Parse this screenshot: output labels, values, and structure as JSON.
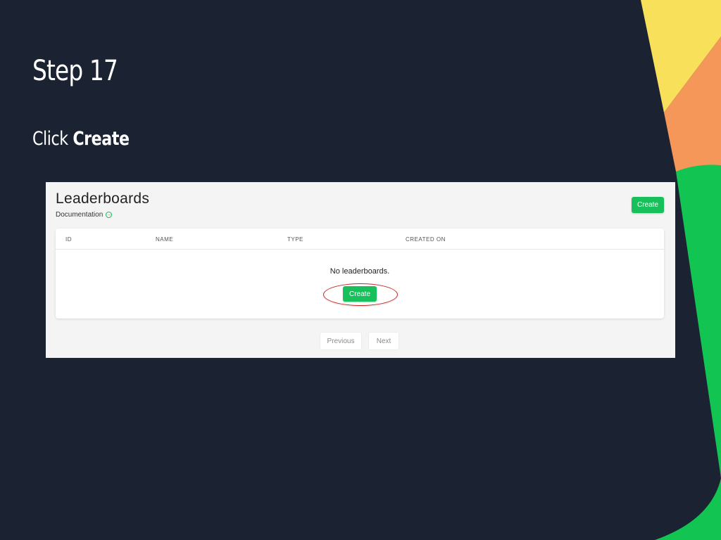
{
  "slide": {
    "title": "Step 17",
    "instruction_prefix": "Click ",
    "instruction_target": "Create"
  },
  "screenshot": {
    "page_title": "Leaderboards",
    "documentation_link": "Documentation",
    "create_button_top": "Create",
    "table": {
      "columns": [
        "ID",
        "NAME",
        "TYPE",
        "CREATED ON"
      ]
    },
    "empty_message": "No leaderboards.",
    "create_button_center": "Create",
    "pagination": {
      "previous_label": "Previous",
      "next_label": "Next"
    }
  },
  "colors": {
    "background": "#1b2332",
    "accent_green": "#17c05b",
    "decor_yellow": "#f9e05a",
    "decor_orange": "#f6975a",
    "highlight_red": "#c62828"
  },
  "icons": {
    "documentation_link_icon": "circle-arrow-right-icon"
  }
}
